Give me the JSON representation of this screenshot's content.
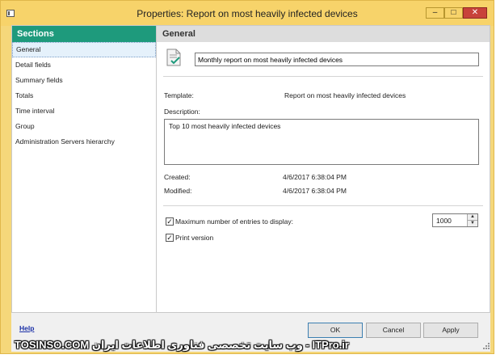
{
  "window": {
    "title": "Properties: Report on most heavily infected devices",
    "min_glyph": "–",
    "max_glyph": "□",
    "close_glyph": "✕"
  },
  "sidebar": {
    "header": "Sections",
    "items": [
      {
        "label": "General",
        "selected": true
      },
      {
        "label": "Detail fields"
      },
      {
        "label": "Summary fields"
      },
      {
        "label": "Totals"
      },
      {
        "label": "Time interval"
      },
      {
        "label": "Group"
      },
      {
        "label": "Administration Servers hierarchy"
      }
    ]
  },
  "general": {
    "header": "General",
    "report_name": "Monthly report on most heavily infected devices",
    "template_label": "Template:",
    "template_value": "Report on most heavily infected devices",
    "description_label": "Description:",
    "description_value": "Top 10 most heavily infected devices",
    "created_label": "Created:",
    "created_value": "4/6/2017 6:38:04 PM",
    "modified_label": "Modified:",
    "modified_value": "4/6/2017 6:38:04 PM",
    "max_entries_label": "Maximum number of entries to display:",
    "max_entries_checked": true,
    "max_entries_value": "1000",
    "print_version_label": "Print version",
    "print_version_checked": true
  },
  "footer": {
    "help": "Help",
    "ok": "OK",
    "cancel": "Cancel",
    "apply": "Apply"
  },
  "watermark": "TOSINSO.COM وب سایت تخصصی فناوری اطلاعات ایران - ITPro.ir",
  "colors": {
    "title_bar": "#f7d36a",
    "sections_header": "#1e9a7c",
    "close_button": "#c8423a",
    "link": "#1a2fa6"
  }
}
